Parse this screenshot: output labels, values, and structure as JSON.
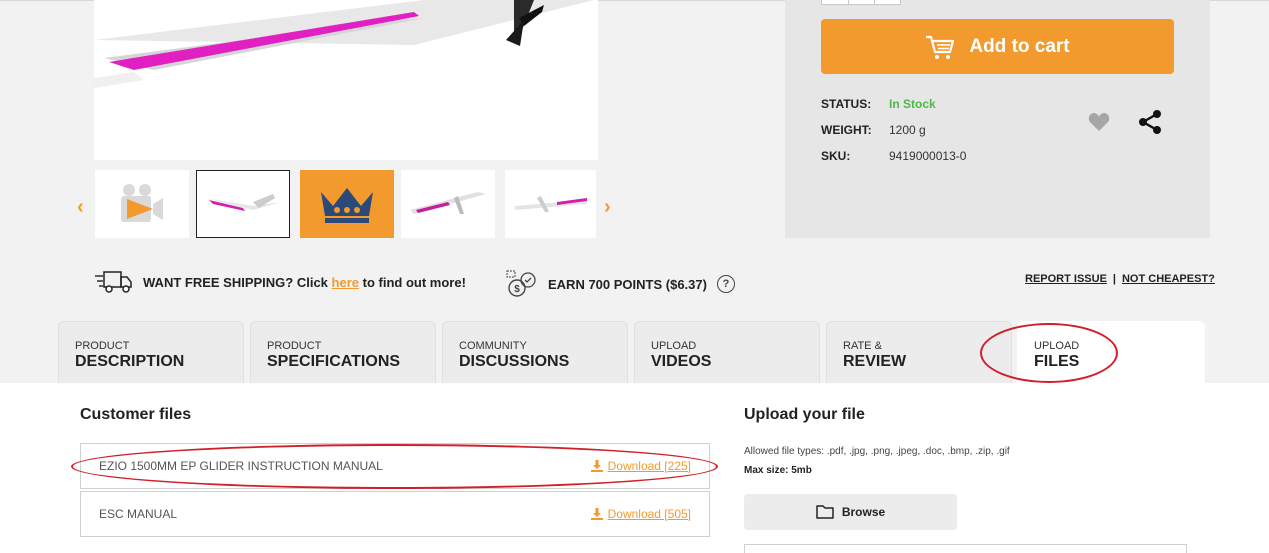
{
  "buy": {
    "add_to_cart": "Add to cart",
    "status_label": "STATUS:",
    "status_value": "In Stock",
    "weight_label": "WEIGHT:",
    "weight_value": "1200 g",
    "sku_label": "SKU:",
    "sku_value": "9419000013-0"
  },
  "strip": {
    "shipping_prefix": "WANT FREE SHIPPING? Click",
    "shipping_link": "here",
    "shipping_suffix": "to find out more!",
    "points": "EARN 700 POINTS ($6.37)",
    "help": "?",
    "report_issue": "REPORT ISSUE",
    "separator": "|",
    "not_cheapest": "NOT CHEAPEST?"
  },
  "tabs": [
    {
      "small": "PRODUCT",
      "big": "DESCRIPTION"
    },
    {
      "small": "PRODUCT",
      "big": "SPECIFICATIONS"
    },
    {
      "small": "COMMUNITY",
      "big": "DISCUSSIONS"
    },
    {
      "small": "UPLOAD",
      "big": "VIDEOS"
    },
    {
      "small": "RATE &",
      "big": "REVIEW"
    },
    {
      "small": "UPLOAD",
      "big": "FILES"
    }
  ],
  "files": {
    "title": "Customer files",
    "items": [
      {
        "name": "EZIO 1500MM EP GLIDER INSTRUCTION MANUAL",
        "download": "Download [225]"
      },
      {
        "name": "ESC MANUAL",
        "download": "Download [505]"
      }
    ]
  },
  "upload": {
    "title": "Upload your file",
    "allowed": "Allowed file types: .pdf, .jpg, .png, .jpeg, .doc, .bmp, .zip, .gif",
    "max_size": "Max size: 5mb",
    "browse": "Browse"
  },
  "colors": {
    "accent": "#f39a2e",
    "in_stock": "#4db848",
    "annotation": "#d0202a"
  }
}
